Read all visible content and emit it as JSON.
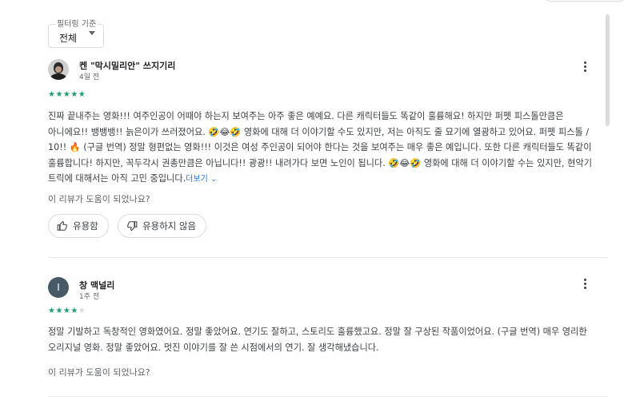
{
  "filter": {
    "label": "필터링 기준",
    "value": "전체"
  },
  "reviews": [
    {
      "name": "켄 \"막시밀리안\" 쓰지기리",
      "date": "4일 전",
      "stars": "★★★★★",
      "stars_empty": "",
      "rating": 5,
      "text": "진짜 끝내주는 영화!!! 여주인공이 어때야 하는지 보여주는 아주 좋은 예예요. 다른 캐릭터들도 똑같이 훌륭해요! 하지만 퍼펫 피스톨만큼은 아니에요!! 뱅뱅뱅!! 늙은이가 쓰러졌어요. 🤣😂🤣 영화에 대해 더 이야기할 수도 있지만, 저는 아직도 줄 묘기에 열광하고 있어요. 퍼펫 피스톨 / 10!! 🔥 (구글 번역) 정말 형편없는 영화!!! 이것은 여성 주인공이 되어야 한다는 것을 보여주는 매우 좋은 예입니다. 또한 다른 캐릭터들도 똑같이 훌륭합니다! 하지만, 꼭두각시 권총만큼은 아닙니다!! 광광!! 내려가다 보면 노인이 됩니다. 🤣😂🤣 영화에 대해 더 이야기할 수는 있지만, 현악기 트릭에 대해서는 아직 고민 중입니다.",
      "more": "더보기",
      "helpful_question": "이 리뷰가 도움이 되었나요?",
      "helpful_yes": "유용함",
      "helpful_no": "유용하지 않음"
    },
    {
      "name": "창 맥널리",
      "initial": "I",
      "date": "1주 전",
      "stars": "★★★★",
      "stars_empty": "★",
      "rating": 4,
      "text": "정말 기발하고 독창적인 영화였어요. 정말 좋았어요. 연기도 잘하고, 스토리도 훌륭했고요. 정말 잘 구상된 작품이었어요. (구글 번역) 매우 영리한 오리지널 영화. 정말 좋았어요. 멋진 이야기를 잘 쓴 시점에서의 연기. 잘 생각해냈습니다.",
      "helpful_question": "이 리뷰가 도움이 되었나요?"
    }
  ],
  "colors": {
    "star": "#1a9e6f",
    "link": "#1a73e8",
    "avatar_bg": "#455a64"
  }
}
